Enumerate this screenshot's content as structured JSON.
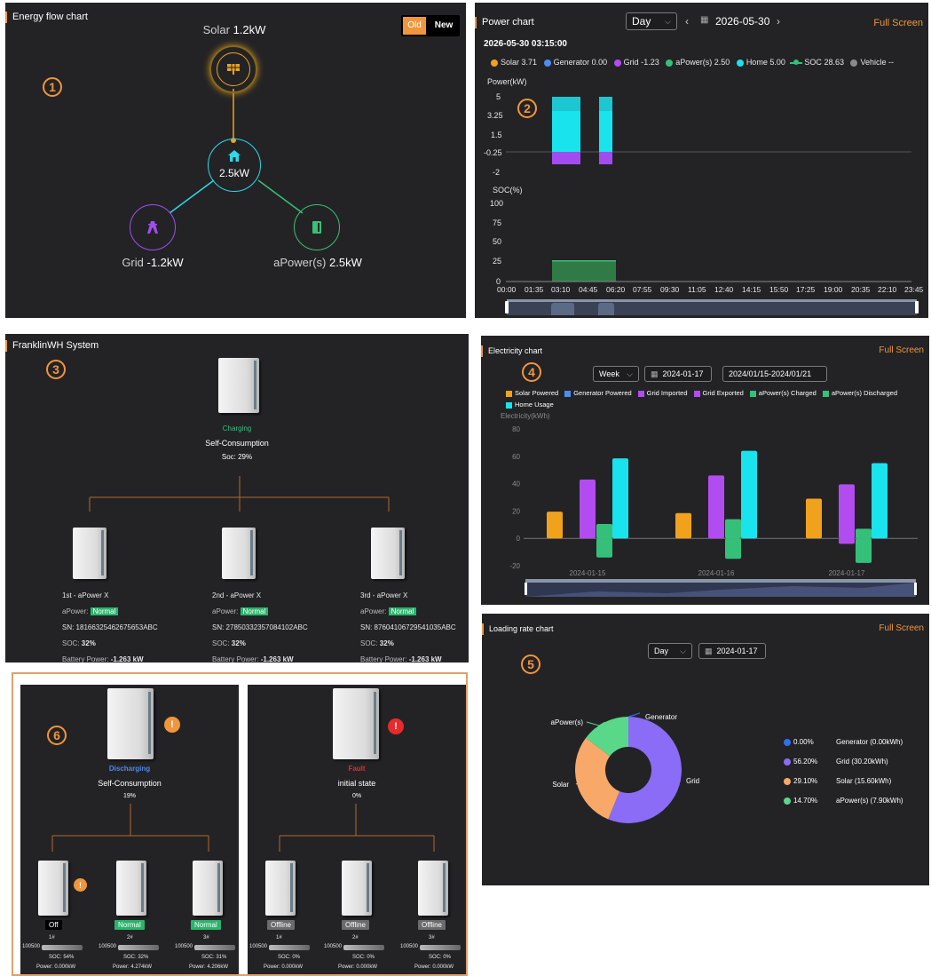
{
  "energy_flow": {
    "title": "Energy flow chart",
    "toggle": {
      "old": "Old",
      "new": "New"
    },
    "solar": {
      "label": "Solar",
      "value": "1.2kW"
    },
    "home": {
      "value": "2.5kW"
    },
    "grid": {
      "label": "Grid",
      "value": "-1.2kW"
    },
    "apower": {
      "label": "aPower(s)",
      "value": "2.5kW"
    },
    "badge": "1",
    "colors": {
      "solar": "#f0a21c",
      "home": "#2bd9e8",
      "grid": "#a24cf0",
      "apower": "#38c074"
    }
  },
  "power_chart": {
    "title": "Power chart",
    "full_screen": "Full Screen",
    "period": "Day",
    "date": "2026-05-30",
    "timestamp": "2026-05-30 03:15:00",
    "badge": "2",
    "legend": [
      {
        "label": "Solar",
        "value": "3.71",
        "color": "#f0a21c"
      },
      {
        "label": "Generator",
        "value": "0.00",
        "color": "#4d8cf5"
      },
      {
        "label": "Grid",
        "value": "-1.23",
        "color": "#b34cf0"
      },
      {
        "label": "aPower(s)",
        "value": "2.50",
        "color": "#35c07a"
      },
      {
        "label": "Home",
        "value": "5.00",
        "color": "#19e3ec"
      },
      {
        "label": "SOC",
        "value": "28.63",
        "color": "#35c07a"
      },
      {
        "label": "Vehicle",
        "value": "--",
        "color": "#8a8a8a"
      }
    ],
    "power_axis": {
      "label": "Power(kW)",
      "ticks": [
        "5",
        "3.25",
        "1.5",
        "-0.25",
        "-2"
      ]
    },
    "soc_axis": {
      "label": "SOC(%)",
      "ticks": [
        "100",
        "75",
        "50",
        "25",
        "0"
      ]
    },
    "x_ticks": [
      "00:00",
      "01:35",
      "03:10",
      "04:45",
      "06:20",
      "07:55",
      "09:30",
      "11:05",
      "12:40",
      "14:15",
      "15:50",
      "17:25",
      "19:00",
      "20:35",
      "22:10",
      "23:45"
    ]
  },
  "system": {
    "title": "FranklinWH System",
    "badge": "3",
    "status": "Charging",
    "mode": "Self-Consumption",
    "soc": "Soc: 29%",
    "units": [
      {
        "name": "1st - aPower X",
        "apower_label": "aPower:",
        "state": "Normal",
        "sn": "SN: 18166325462675653ABC",
        "soc_label": "SOC:",
        "soc": "32%",
        "power_label": "Battery Power:",
        "power": "-1.263 kW"
      },
      {
        "name": "2nd - aPower X",
        "apower_label": "aPower:",
        "state": "Normal",
        "sn": "SN: 27850332357084102ABC",
        "soc_label": "SOC:",
        "soc": "32%",
        "power_label": "Battery Power:",
        "power": "-1.263 kW"
      },
      {
        "name": "3rd - aPower X",
        "apower_label": "aPower:",
        "state": "Normal",
        "sn": "SN: 87604106729541035ABC",
        "soc_label": "SOC:",
        "soc": "32%",
        "power_label": "Battery Power:",
        "power": "-1.263 kW"
      }
    ]
  },
  "electricity": {
    "title": "Electricity chart",
    "full_screen": "Full Screen",
    "period": "Week",
    "date": "2024-01-17",
    "range": "2024/01/15-2024/01/21",
    "badge": "4",
    "ylabel": "Electricity(kWh)",
    "y_ticks": [
      "80",
      "60",
      "40",
      "20",
      "0",
      "-20"
    ]
  },
  "chart_data": {
    "type": "bar",
    "categories": [
      "2024-01-15",
      "2024-01-16",
      "2024-01-17"
    ],
    "series": [
      {
        "name": "Solar Powered",
        "color": "#f0a21c",
        "values": [
          19.5,
          18.5,
          29
        ]
      },
      {
        "name": "Generator Powered",
        "color": "#4d8cf5",
        "values": [
          0,
          0,
          0
        ]
      },
      {
        "name": "Grid Imported",
        "color": "#b34cf0",
        "values": [
          43,
          46,
          39.5
        ]
      },
      {
        "name": "Grid Exported",
        "color": "#b34cf0",
        "values": [
          0,
          0,
          -4
        ]
      },
      {
        "name": "aPower(s) Charged",
        "color": "#35c07a",
        "values": [
          -14,
          -15,
          -18
        ]
      },
      {
        "name": "aPower(s) Discharged",
        "color": "#35c07a",
        "values": [
          10.5,
          14,
          7
        ]
      },
      {
        "name": "Home Usage",
        "color": "#19e3ec",
        "values": [
          58.5,
          64,
          55
        ]
      }
    ],
    "ylabel": "Electricity(kWh)",
    "ylim": [
      -20,
      80
    ],
    "legend_position": "top"
  },
  "loading": {
    "title": "Loading rate chart",
    "full_screen": "Full Screen",
    "period": "Day",
    "date": "2024-01-17",
    "badge": "5",
    "slices": [
      {
        "name": "Generator",
        "pct": "0.00%",
        "desc": "Generator  (0.00kWh)",
        "value": 0.0,
        "color": "#2f6ff0"
      },
      {
        "name": "Grid",
        "pct": "56.20%",
        "desc": "Grid  (30.20kWh)",
        "value": 56.2,
        "color": "#8a6cf6"
      },
      {
        "name": "Solar",
        "pct": "29.10%",
        "desc": "Solar  (15.60kWh)",
        "value": 29.1,
        "color": "#f8a868"
      },
      {
        "name": "aPower(s)",
        "pct": "14.70%",
        "desc": "aPower(s)  (7.90kWh)",
        "value": 14.7,
        "color": "#5ad88a"
      }
    ]
  },
  "variants": {
    "badge": "6",
    "left": {
      "status": "Discharging",
      "mode": "Self-Consumption",
      "soc": "19%",
      "units": [
        {
          "idx": "1#",
          "state": "Off",
          "sn": "100500",
          "soc": "SOC: 54%",
          "power": "Power: 0.000kW"
        },
        {
          "idx": "2#",
          "state": "Normal",
          "sn": "100500",
          "soc": "SOC: 32%",
          "power": "Power: 4.274kW"
        },
        {
          "idx": "3#",
          "state": "Normal",
          "sn": "100500",
          "soc": "SOC: 31%",
          "power": "Power: 4.206kW"
        }
      ]
    },
    "right": {
      "status": "Fault",
      "mode": "initial state",
      "soc": "0%",
      "units": [
        {
          "idx": "1#",
          "state": "Offline",
          "sn": "100500",
          "soc": "SOC: 0%",
          "power": "Power: 0.000kW"
        },
        {
          "idx": "2#",
          "state": "Offline",
          "sn": "100500",
          "soc": "SOC: 0%",
          "power": "Power: 0.000kW"
        },
        {
          "idx": "3#",
          "state": "Offline",
          "sn": "100500",
          "soc": "SOC: 0%",
          "power": "Power: 0.000kW"
        }
      ]
    }
  }
}
